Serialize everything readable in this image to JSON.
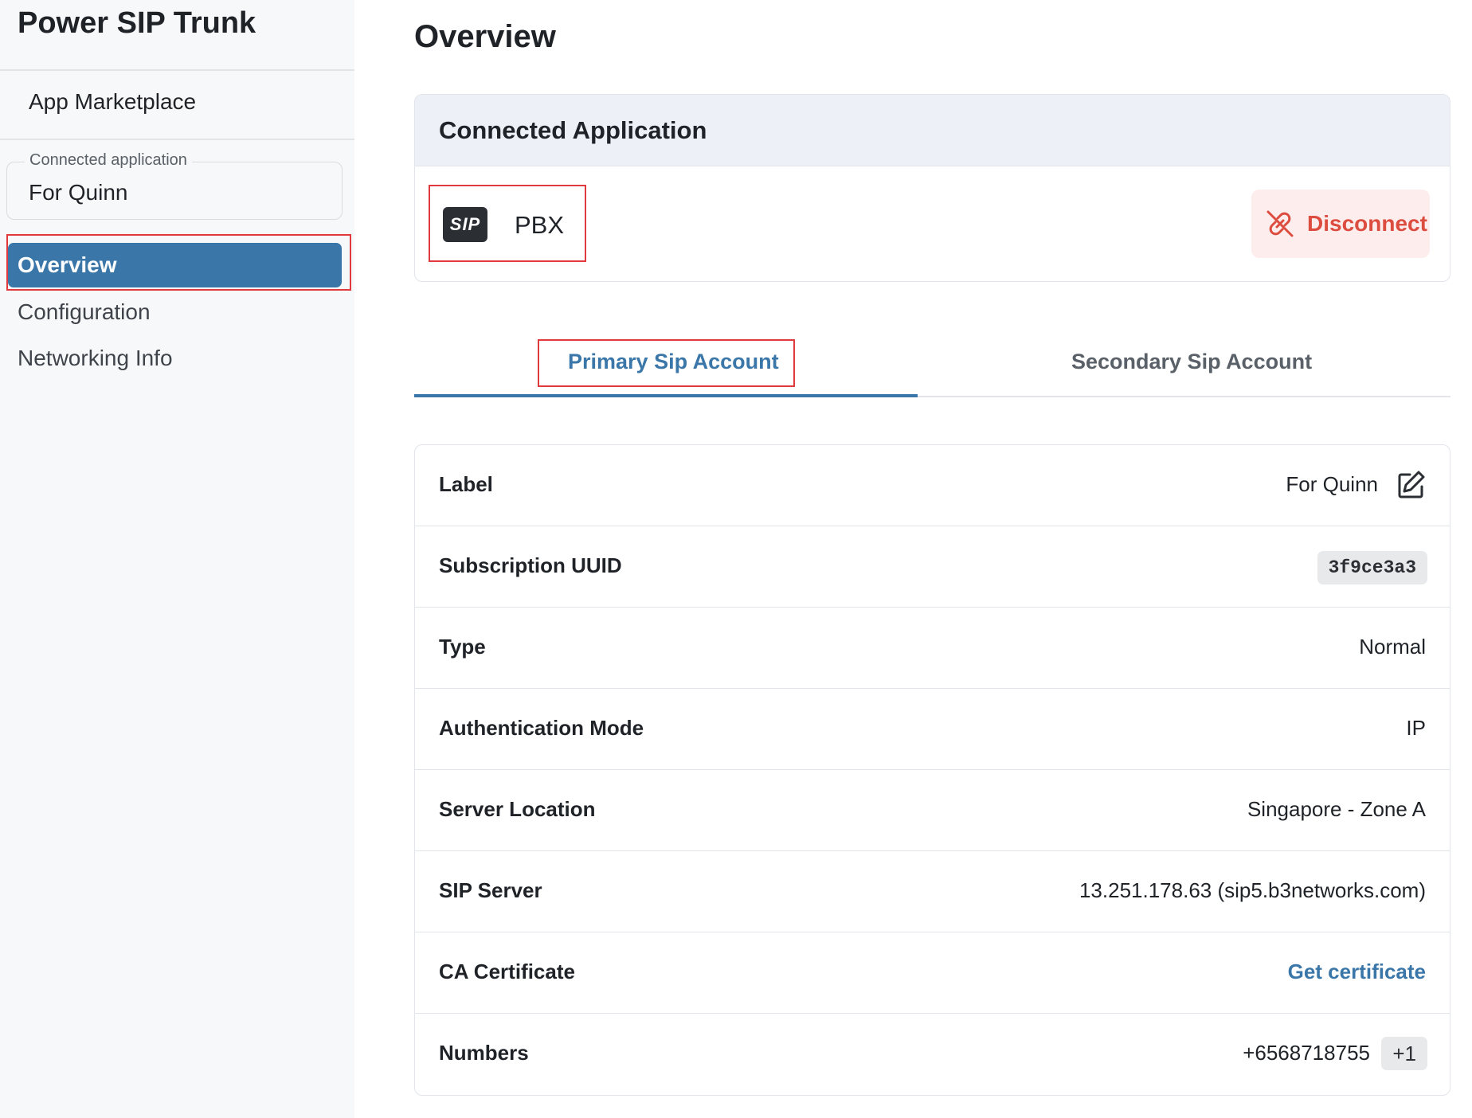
{
  "sidebar": {
    "app_title": "Power SIP Trunk",
    "marketplace_label": "App Marketplace",
    "connected_app_select": {
      "legend": "Connected application",
      "value": "For Quinn"
    },
    "nav": {
      "overview": "Overview",
      "configuration": "Configuration",
      "networking": "Networking Info"
    }
  },
  "main": {
    "page_title": "Overview",
    "connected_card": {
      "header": "Connected Application",
      "logo_text": "SIP",
      "app_name": "PBX",
      "disconnect_label": "Disconnect"
    },
    "tabs": {
      "primary": "Primary Sip Account",
      "secondary": "Secondary Sip Account"
    },
    "details": {
      "label": {
        "title": "Label",
        "value": "For Quinn"
      },
      "uuid": {
        "title": "Subscription UUID",
        "value": "3f9ce3a3"
      },
      "type": {
        "title": "Type",
        "value": "Normal"
      },
      "auth": {
        "title": "Authentication Mode",
        "value": "IP"
      },
      "location": {
        "title": "Server Location",
        "value": "Singapore - Zone A"
      },
      "server": {
        "title": "SIP Server",
        "value": "13.251.178.63 (sip5.b3networks.com)"
      },
      "ca": {
        "title": "CA Certificate",
        "value": "Get certificate"
      },
      "numbers": {
        "title": "Numbers",
        "value": "+6568718755",
        "extra": "+1"
      }
    }
  },
  "colors": {
    "accent": "#3a77a8",
    "danger": "#dc4c3f",
    "highlight_box": "#e0393e",
    "header_bg": "#edf1f7",
    "sidebar_bg": "#f7f8f9"
  }
}
